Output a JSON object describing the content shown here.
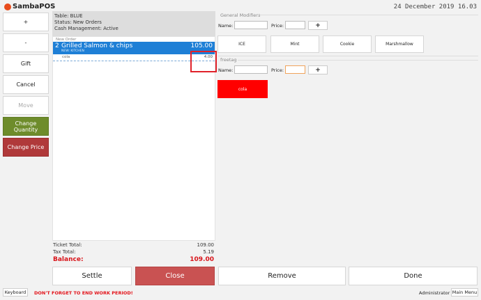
{
  "app": {
    "name": "SambaPOS",
    "datetime": "24 December 2019 16.03",
    "brand_color": "#e84c1c"
  },
  "left_buttons": [
    {
      "label": "+",
      "state": "normal"
    },
    {
      "label": "-",
      "state": "normal"
    },
    {
      "label": "Gift",
      "state": "normal"
    },
    {
      "label": "Cancel",
      "state": "normal"
    },
    {
      "label": "Move",
      "state": "disabled"
    },
    {
      "label": "Change Quantity",
      "state": "green",
      "color": "#6e8c2b"
    },
    {
      "label": "Change Price",
      "state": "red",
      "color": "#b0393a"
    }
  ],
  "ticket_info": {
    "table": "Table: BLUE",
    "status": "Status: New Orders",
    "cash": "Cash Management: Active"
  },
  "ticket": {
    "section_label": "New Order",
    "order": {
      "quantity": "2",
      "name": "Grilled Salmon & chips",
      "price": "105.00",
      "tag": "NEW: KITCHEN",
      "row_color": "#1e7fd6"
    },
    "modifier": {
      "name": "cola",
      "price": "4.00"
    }
  },
  "totals": {
    "ticket_total_label": "Ticket Total:",
    "ticket_total_value": "109.00",
    "tax_total_label": "Tax Total:",
    "tax_total_value": "5.19",
    "balance_label": "Balance:",
    "balance_value": "109.00",
    "balance_color": "#d8141a"
  },
  "actions": {
    "settle": "Settle",
    "close": "Close",
    "remove": "Remove",
    "done": "Done"
  },
  "general_modifiers": {
    "title": "General Modifiers",
    "name_label": "Name:",
    "price_label": "Price:",
    "add_label": "+",
    "items": [
      "ICE",
      "Mint",
      "Cookie",
      "Marshmallow"
    ]
  },
  "freetag": {
    "title": "freetag",
    "name_label": "Name:",
    "price_label": "Price:",
    "add_label": "+",
    "items": [
      "cola"
    ],
    "item_color": "#ff0000"
  },
  "footer": {
    "keyboard": "Keyboard",
    "warning": "DON'T FORGET TO END WORK PERIOD!",
    "user": "Administrator",
    "main_menu": "Main Menu"
  }
}
